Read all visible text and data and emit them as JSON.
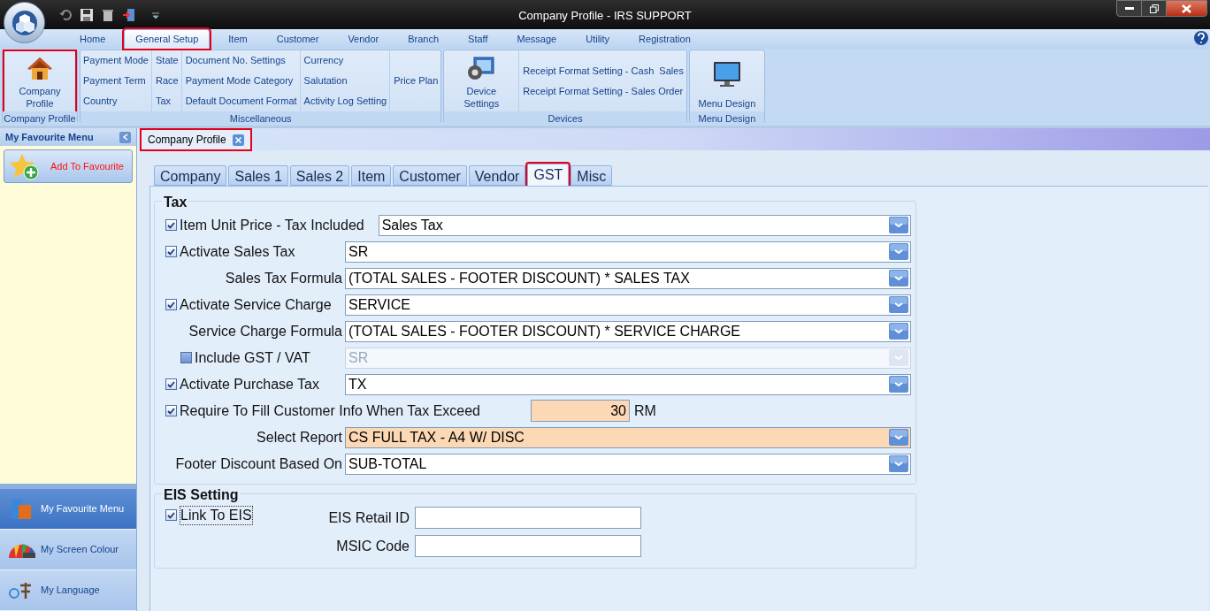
{
  "window": {
    "title": "Company Profile - IRS SUPPORT"
  },
  "menu_tabs": [
    {
      "label": "Home",
      "selected": false,
      "highlighted": false
    },
    {
      "label": "General Setup",
      "selected": true,
      "highlighted": true
    },
    {
      "label": "Item",
      "selected": false,
      "highlighted": false
    },
    {
      "label": "Customer",
      "selected": false,
      "highlighted": false
    },
    {
      "label": "Vendor",
      "selected": false,
      "highlighted": false
    },
    {
      "label": "Branch",
      "selected": false,
      "highlighted": false
    },
    {
      "label": "Staff",
      "selected": false,
      "highlighted": false
    },
    {
      "label": "Message",
      "selected": false,
      "highlighted": false
    },
    {
      "label": "Utility",
      "selected": false,
      "highlighted": false
    },
    {
      "label": "Registration",
      "selected": false,
      "highlighted": false
    }
  ],
  "ribbon": {
    "groups": [
      {
        "label": "Company Profile",
        "columns": [
          [
            {
              "kind": "large",
              "label": "Company Profile",
              "highlighted": true
            }
          ]
        ]
      },
      {
        "label": "Miscellaneous",
        "columns": [
          [
            {
              "kind": "small",
              "label": "Payment Mode"
            },
            {
              "kind": "small",
              "label": "Payment Term"
            },
            {
              "kind": "small",
              "label": "Country"
            }
          ],
          [
            {
              "kind": "small",
              "label": "State"
            },
            {
              "kind": "small",
              "label": "Race"
            },
            {
              "kind": "small",
              "label": "Tax"
            }
          ],
          [
            {
              "kind": "small",
              "label": "Document No. Settings"
            },
            {
              "kind": "small",
              "label": "Payment Mode Category"
            },
            {
              "kind": "small",
              "label": "Default Document Format"
            }
          ],
          [
            {
              "kind": "small",
              "label": "Currency"
            },
            {
              "kind": "small",
              "label": "Salutation"
            },
            {
              "kind": "small",
              "label": "Activity Log Setting"
            }
          ],
          [
            {
              "kind": "small",
              "label": "Price Plan"
            }
          ]
        ]
      },
      {
        "label": "Devices",
        "columns": [
          [
            {
              "kind": "large",
              "label": "Device Settings",
              "highlighted": false
            }
          ],
          [
            {
              "kind": "small",
              "label": "Receipt Format Setting - Cash  Sales"
            },
            {
              "kind": "small",
              "label": "Receipt Format Setting - Sales Order"
            }
          ]
        ]
      },
      {
        "label": "Menu Design",
        "columns": [
          [
            {
              "kind": "large",
              "label": "Menu Design",
              "highlighted": false
            }
          ]
        ]
      }
    ]
  },
  "sidebar": {
    "title": "My Favourite Menu",
    "add_button": "Add To Favourite",
    "items": [
      {
        "label": "My Favourite Menu",
        "selected": true
      },
      {
        "label": "My Screen Colour",
        "selected": false
      },
      {
        "label": "My Language",
        "selected": false
      }
    ]
  },
  "document_tabs": [
    {
      "label": "Company Profile",
      "highlighted": true
    }
  ],
  "tabs": [
    {
      "label": "Company",
      "selected": false,
      "highlighted": false
    },
    {
      "label": "Sales 1",
      "selected": false,
      "highlighted": false
    },
    {
      "label": "Sales 2",
      "selected": false,
      "highlighted": false
    },
    {
      "label": "Item",
      "selected": false,
      "highlighted": false
    },
    {
      "label": "Customer",
      "selected": false,
      "highlighted": false
    },
    {
      "label": "Vendor",
      "selected": false,
      "highlighted": false
    },
    {
      "label": "GST",
      "selected": true,
      "highlighted": true
    },
    {
      "label": "Misc",
      "selected": false,
      "highlighted": false
    }
  ],
  "tax": {
    "title": "Tax",
    "rows": [
      {
        "kind": "combo",
        "label": "Item Unit Price - Tax Included",
        "checked": true,
        "value": "Sales Tax",
        "disabled": false,
        "highlighted": false
      },
      {
        "kind": "combo",
        "label": "Activate Sales Tax",
        "checked": true,
        "value": "SR",
        "disabled": false,
        "highlighted": false
      },
      {
        "kind": "combo",
        "label": "Sales Tax Formula",
        "value": "(TOTAL SALES - FOOTER DISCOUNT) * SALES TAX",
        "disabled": false,
        "highlighted": false
      },
      {
        "kind": "combo",
        "label": "Activate Service Charge",
        "checked": true,
        "value": "SERVICE",
        "disabled": false,
        "highlighted": false
      },
      {
        "kind": "combo",
        "label": "Service Charge Formula",
        "value": "(TOTAL SALES - FOOTER DISCOUNT) * SERVICE CHARGE",
        "disabled": false,
        "highlighted": false
      },
      {
        "kind": "combo",
        "label": "Include GST / VAT",
        "checked": false,
        "value": "SR",
        "disabled": true
      },
      {
        "kind": "combo",
        "label": "Activate Purchase Tax",
        "checked": true,
        "value": "TX",
        "disabled": false,
        "highlighted": false
      },
      {
        "kind": "number",
        "label": "Require To Fill Customer Info When Tax Exceed",
        "checked": true,
        "value": "30",
        "unit": "RM",
        "highlighted": true
      },
      {
        "kind": "combo",
        "label": "Select Report",
        "value": "CS FULL TAX - A4 W/ DISC",
        "disabled": false,
        "highlighted": true
      },
      {
        "kind": "combo",
        "label": "Footer Discount Based On",
        "value": "SUB-TOTAL",
        "disabled": false,
        "highlighted": false
      }
    ]
  },
  "eis": {
    "title": "EIS Setting",
    "link": {
      "label": "Link To EIS",
      "checked": true
    },
    "fields": [
      {
        "label": "EIS Retail ID"
      },
      {
        "label": "MSIC Code"
      }
    ]
  }
}
